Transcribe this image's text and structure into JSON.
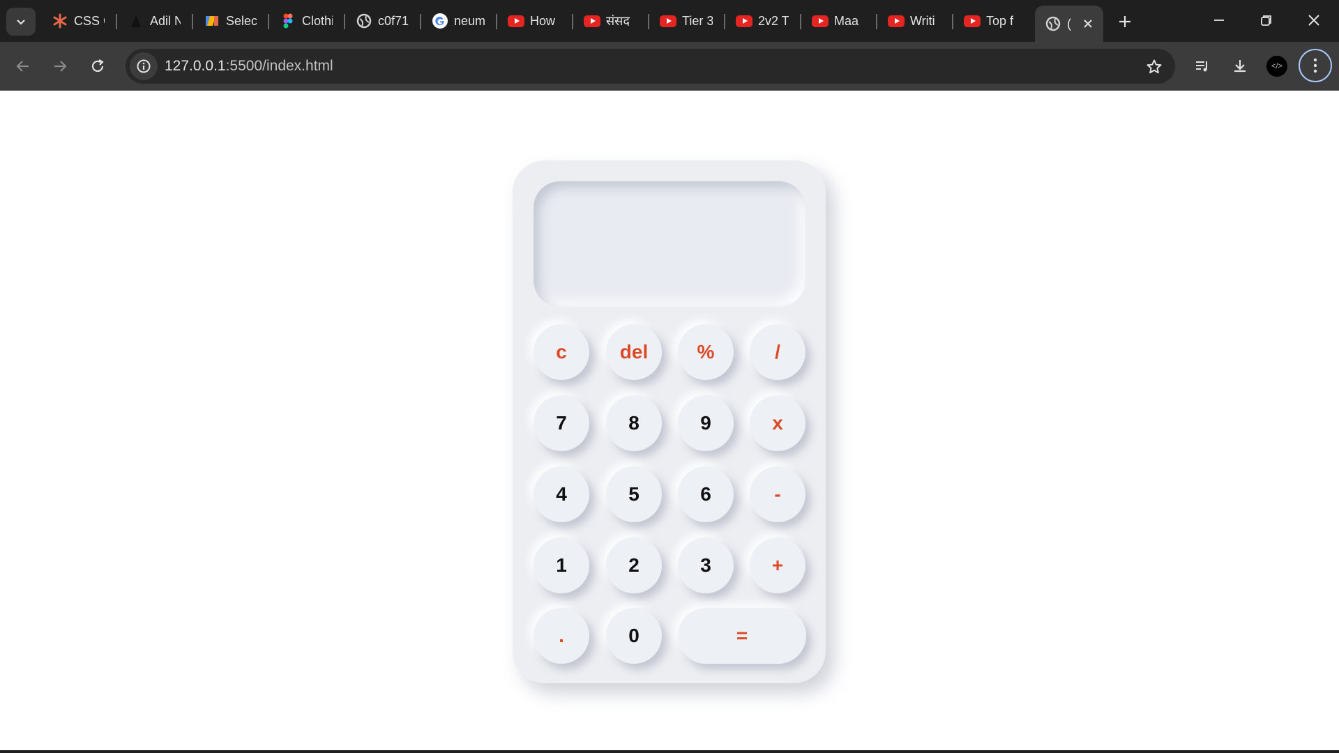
{
  "browser": {
    "tabs": [
      {
        "title": "CSS Gr",
        "icon": "asterisk-icon"
      },
      {
        "title": "Adil N",
        "icon": "dark-app-icon"
      },
      {
        "title": "Select",
        "icon": "app-icon"
      },
      {
        "title": "Clothi",
        "icon": "figma-icon"
      },
      {
        "title": "c0f71",
        "icon": "globe-icon"
      },
      {
        "title": "neum",
        "icon": "google-icon"
      },
      {
        "title": "How",
        "icon": "youtube-icon"
      },
      {
        "title": "संसद",
        "icon": "youtube-icon"
      },
      {
        "title": "Tier 3",
        "icon": "youtube-icon"
      },
      {
        "title": "2v2 T",
        "icon": "youtube-icon"
      },
      {
        "title": "Maa",
        "icon": "youtube-icon"
      },
      {
        "title": "Writi",
        "icon": "youtube-icon"
      },
      {
        "title": "Top f",
        "icon": "youtube-icon"
      },
      {
        "title": "(",
        "icon": "globe-icon",
        "active": true
      }
    ],
    "url_host": "127.0.0.1",
    "url_rest": ":5500/index.html"
  },
  "calculator": {
    "display_value": "",
    "keys": {
      "clear": "c",
      "delete": "del",
      "percent": "%",
      "divide": "/",
      "seven": "7",
      "eight": "8",
      "nine": "9",
      "multiply": "x",
      "four": "4",
      "five": "5",
      "six": "6",
      "subtract": "-",
      "one": "1",
      "two": "2",
      "three": "3",
      "add": "+",
      "decimal": ".",
      "zero": "0",
      "equals": "="
    },
    "colors": {
      "operator": "#dc4a28",
      "digit": "#111111",
      "body": "#eceef2"
    }
  }
}
